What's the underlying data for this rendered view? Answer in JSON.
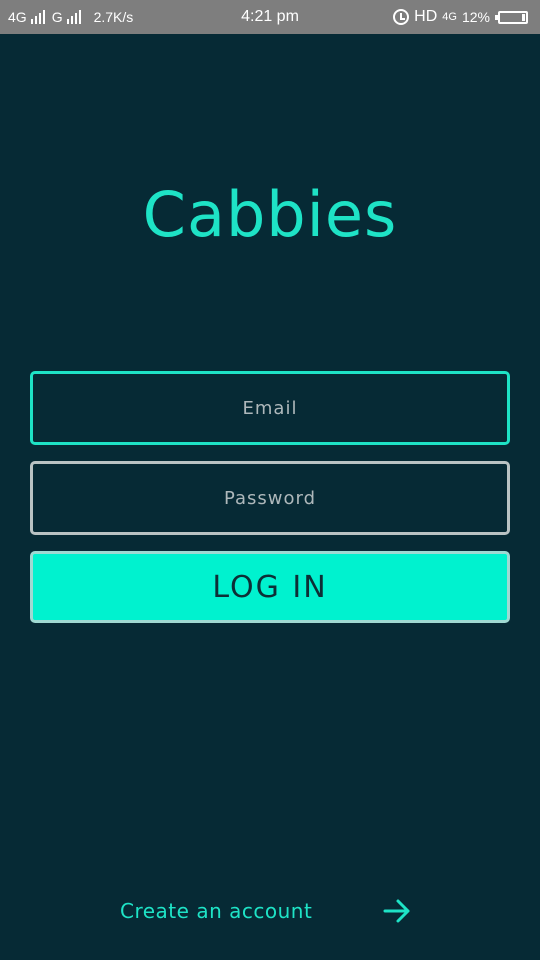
{
  "status_bar": {
    "network_1": "4G",
    "network_2": "G",
    "speed": "2.7K/s",
    "time": "4:21 pm",
    "hd": "HD",
    "network_3": "4G",
    "battery": "12%",
    "battery_level": 0.12
  },
  "app": {
    "title": "Cabbies",
    "brand_color": "#1ee3c6",
    "background_color": "#062a35"
  },
  "form": {
    "email_placeholder": "Email",
    "email_value": "",
    "password_placeholder": "Password",
    "password_value": "",
    "login_label": "LOG IN",
    "login_color": "#00f2cf"
  },
  "footer": {
    "create_account_label": "Create an account",
    "arrow_icon": "arrow-right-icon"
  }
}
